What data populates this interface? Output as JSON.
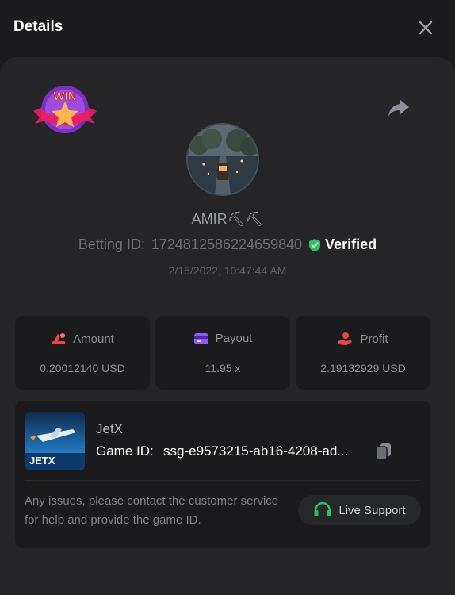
{
  "header": {
    "title": "Details",
    "close_icon": "close-icon"
  },
  "badge": {
    "text": "WIN",
    "icon": "win-star-badge-icon"
  },
  "share": {
    "icon": "share-icon"
  },
  "user": {
    "name": "AMIR⛏⛏",
    "betting_id_label": "Betting ID:",
    "betting_id": "1724812586224659840",
    "verified_label": "Verified",
    "verified_color": "#22c55e",
    "timestamp": "2/15/2022, 10:47:44 AM"
  },
  "stats": [
    {
      "label": "Amount",
      "value": "0.20012140 USD",
      "icon": "amount-icon",
      "color": "#ef4444"
    },
    {
      "label": "Payout",
      "value": "11.95 x",
      "icon": "payout-card-icon",
      "color": "#8b5cf6"
    },
    {
      "label": "Profit",
      "value": "2.19132929 USD",
      "icon": "profit-hand-icon",
      "color": "#ef4444"
    }
  ],
  "game": {
    "name": "JetX",
    "thumb_text": "JETX",
    "id_label": "Game ID:",
    "id_value": "ssg-e9573215-ab16-4208-ad...",
    "copy_icon": "copy-icon"
  },
  "support": {
    "help_text": "Any issues, please contact the customer service for help and provide the game ID.",
    "button_label": "Live Support",
    "icon": "headset-icon",
    "icon_color": "#22c55e"
  }
}
